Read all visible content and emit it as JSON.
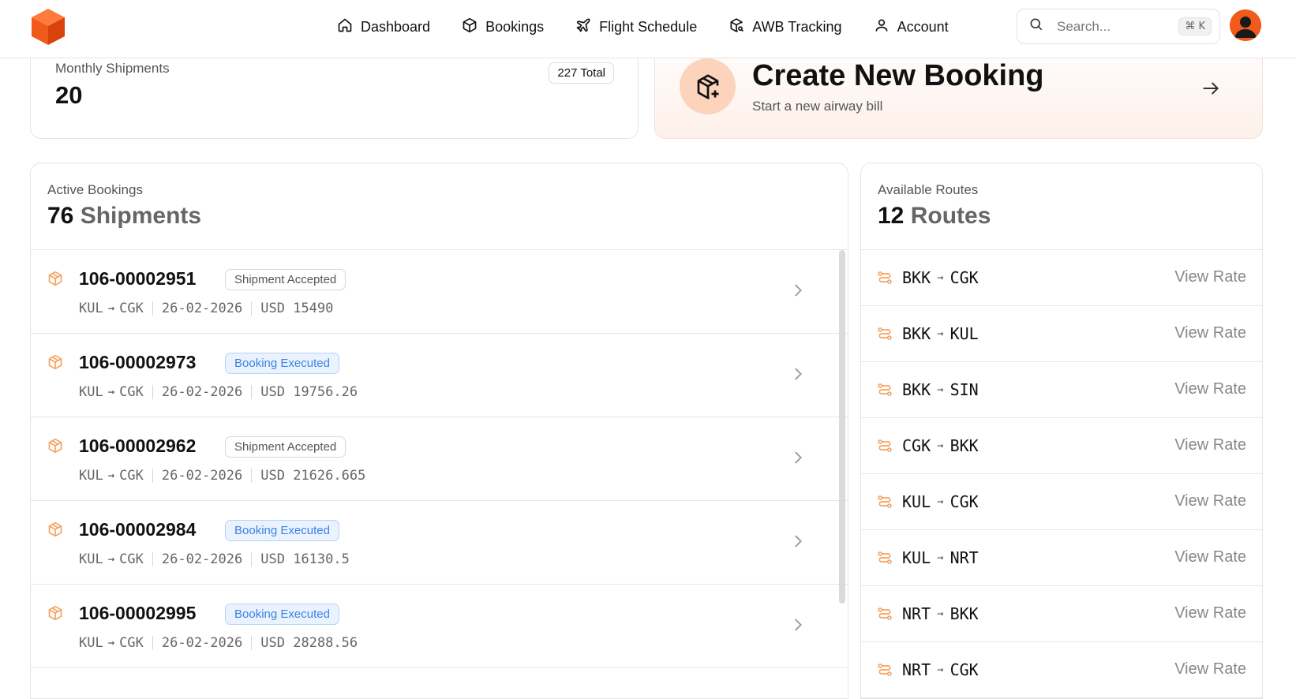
{
  "nav": {
    "items": [
      {
        "label": "Dashboard",
        "icon": "home-icon"
      },
      {
        "label": "Bookings",
        "icon": "box-icon"
      },
      {
        "label": "Flight Schedule",
        "icon": "plane-icon"
      },
      {
        "label": "AWB Tracking",
        "icon": "package-search-icon"
      },
      {
        "label": "Account",
        "icon": "user-icon"
      }
    ]
  },
  "search": {
    "placeholder": "Search...",
    "shortcut": "⌘ K"
  },
  "brand": {
    "accent": "#f05a1a",
    "accent_light": "#fcd3bb"
  },
  "monthly": {
    "label": "Monthly Shipments",
    "value": "20",
    "total": "227 Total"
  },
  "create_booking": {
    "title": "Create New Booking",
    "subtitle": "Start a new airway bill"
  },
  "bookings": {
    "label": "Active Bookings",
    "count": "76",
    "unit": "Shipments",
    "rows": [
      {
        "awb": "106-00002951",
        "status": "Shipment Accepted",
        "status_type": "accepted",
        "origin": "KUL",
        "dest": "CGK",
        "date": "26-02-2026",
        "currency": "USD",
        "amount": "15490"
      },
      {
        "awb": "106-00002973",
        "status": "Booking Executed",
        "status_type": "executed",
        "origin": "KUL",
        "dest": "CGK",
        "date": "26-02-2026",
        "currency": "USD",
        "amount": "19756.26"
      },
      {
        "awb": "106-00002962",
        "status": "Shipment Accepted",
        "status_type": "accepted",
        "origin": "KUL",
        "dest": "CGK",
        "date": "26-02-2026",
        "currency": "USD",
        "amount": "21626.665"
      },
      {
        "awb": "106-00002984",
        "status": "Booking Executed",
        "status_type": "executed",
        "origin": "KUL",
        "dest": "CGK",
        "date": "26-02-2026",
        "currency": "USD",
        "amount": "16130.5"
      },
      {
        "awb": "106-00002995",
        "status": "Booking Executed",
        "status_type": "executed",
        "origin": "KUL",
        "dest": "CGK",
        "date": "26-02-2026",
        "currency": "USD",
        "amount": "28288.56"
      }
    ]
  },
  "routes": {
    "label": "Available Routes",
    "count": "12",
    "unit": "Routes",
    "action_label": "View Rate",
    "rows": [
      {
        "origin": "BKK",
        "dest": "CGK"
      },
      {
        "origin": "BKK",
        "dest": "KUL"
      },
      {
        "origin": "BKK",
        "dest": "SIN"
      },
      {
        "origin": "CGK",
        "dest": "BKK"
      },
      {
        "origin": "KUL",
        "dest": "CGK"
      },
      {
        "origin": "KUL",
        "dest": "NRT"
      },
      {
        "origin": "NRT",
        "dest": "BKK"
      },
      {
        "origin": "NRT",
        "dest": "CGK"
      }
    ]
  }
}
